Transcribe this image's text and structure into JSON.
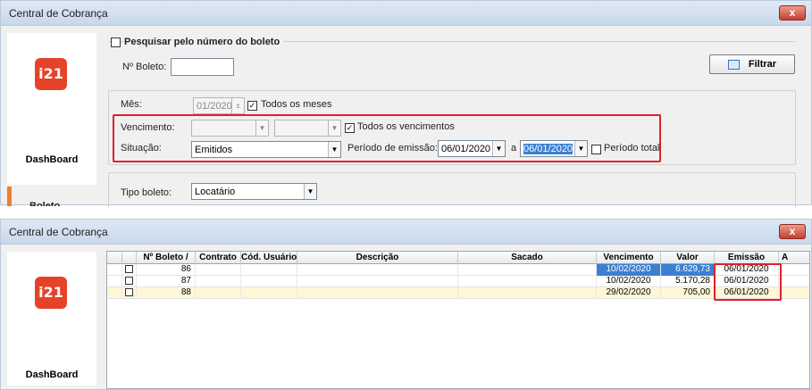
{
  "window1": {
    "title": "Central de Cobrança",
    "close_glyph": "x",
    "logo_text": "i21",
    "sidebar_dashboard": "DashBoard",
    "sidebar_boleto": "Boleto",
    "search_by_number_label": "Pesquisar pelo número do boleto",
    "nro_boleto_label": "Nº Boleto:",
    "nro_boleto_value": "",
    "filter_button": "Filtrar",
    "mes_label": "Mês:",
    "mes_value": "01/2020",
    "todos_meses_label": "Todos os meses",
    "vencimento_label": "Vencimento:",
    "vencimento_from": "",
    "a_label": "a",
    "vencimento_to": "",
    "todos_vencimentos_label": "Todos os vencimentos",
    "situacao_label": "Situação:",
    "situacao_value": "Emitidos",
    "periodo_emissao_label": "Período de emissão:",
    "periodo_from": "06/01/2020",
    "periodo_to": "06/01/2020",
    "periodo_total_label": "Período total",
    "tipo_boleto_label": "Tipo boleto:",
    "tipo_boleto_value": "Locatário",
    "checked_glyph": "✓",
    "spin_glyph": "±",
    "dd_glyph": "▼"
  },
  "window2": {
    "title": "Central de Cobrança",
    "close_glyph": "x",
    "logo_text": "i21",
    "sidebar_dashboard": "DashBoard",
    "columns": {
      "nro": "Nº Boleto /",
      "contrato": "Contrato",
      "cod_usuario": "Cód. Usuário",
      "descricao": "Descrição",
      "sacado": "Sacado",
      "vencimento": "Vencimento",
      "valor": "Valor",
      "emissao": "Emissão",
      "extra": "A"
    },
    "rows": [
      {
        "nro": "86",
        "vencimento": "10/02/2020",
        "valor": "6.629,73",
        "emissao": "06/01/2020"
      },
      {
        "nro": "87",
        "vencimento": "10/02/2020",
        "valor": "5.170,28",
        "emissao": "06/01/2020"
      },
      {
        "nro": "88",
        "vencimento": "29/02/2020",
        "valor": "705,00",
        "emissao": "06/01/2020"
      }
    ]
  },
  "colors": {
    "highlight_box": "#e0202a",
    "logo_bg": "#e4432a",
    "selected_cell": "#3b7fd3",
    "row_yellow": "#fdf7d7"
  }
}
